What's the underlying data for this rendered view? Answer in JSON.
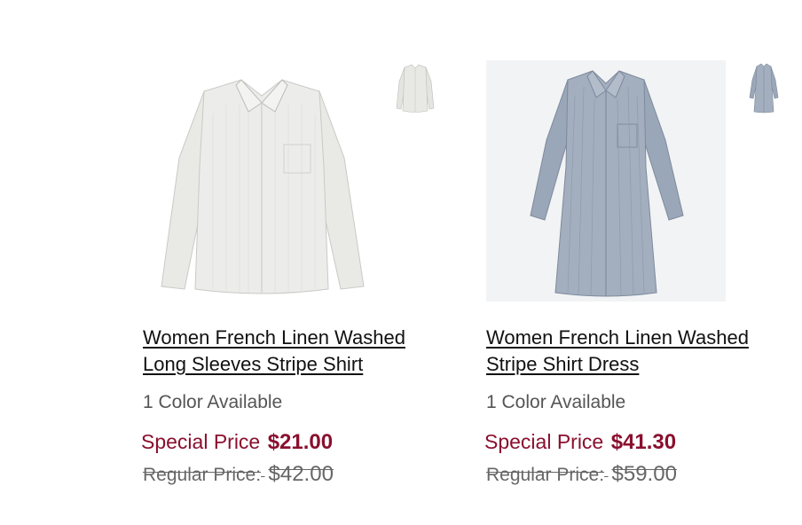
{
  "products": [
    {
      "title_line1": "Women French Linen Washed",
      "title_line2": "Long Sleeves Stripe Shirt",
      "colors_available": "1 Color Available",
      "special_label": "Special Price",
      "special_price": "$21.00",
      "regular_label": "Regular Price:",
      "regular_price": "$42.00",
      "color": "#e9e9e6"
    },
    {
      "title_line1": "Women French Linen Washed",
      "title_line2": "Stripe Shirt Dress",
      "colors_available": "1 Color Available",
      "special_label": "Special Price",
      "special_price": "$41.30",
      "regular_label": "Regular Price:",
      "regular_price": "$59.00",
      "color": "#9aa7b8"
    }
  ],
  "colors": {
    "price_accent": "#8a0f2e",
    "text": "#111111",
    "muted": "#555555"
  }
}
